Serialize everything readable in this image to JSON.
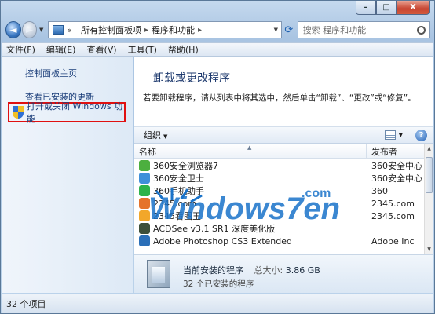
{
  "window": {
    "caption_min": "–",
    "caption_max": "□",
    "caption_close": "X"
  },
  "nav": {
    "back_glyph": "◄",
    "forward_glyph": "►",
    "address_prefix": "«",
    "address_crumbs": [
      "所有控制面板项",
      "程序和功能"
    ],
    "search_placeholder": "搜索 程序和功能"
  },
  "menu": [
    "文件(F)",
    "编辑(E)",
    "查看(V)",
    "工具(T)",
    "帮助(H)"
  ],
  "left_pane": {
    "links": [
      "控制面板主页",
      "查看已安装的更新"
    ],
    "feature_link": "打开或关闭 Windows 功能"
  },
  "main": {
    "title": "卸载或更改程序",
    "description": "若要卸载程序，请从列表中将其选中，然后单击“卸载”、“更改”或“修复”。",
    "organize_label": "组织",
    "columns": [
      "名称",
      "发布者"
    ],
    "programs": [
      {
        "name": "360安全浏览器7",
        "publisher": "360安全中心",
        "color": "#4caf3f"
      },
      {
        "name": "360安全卫士",
        "publisher": "360安全中心",
        "color": "#3f8fd9"
      },
      {
        "name": "360手机助手",
        "publisher": "360",
        "color": "#2db34a"
      },
      {
        "name": "2345.com",
        "publisher": "2345.com",
        "color": "#e5732b"
      },
      {
        "name": "2345看图王",
        "publisher": "2345.com",
        "color": "#f2a72a"
      },
      {
        "name": "ACDSee v3.1 SR1 深度美化版",
        "publisher": "",
        "color": "#3d4f3a"
      },
      {
        "name": "Adobe Photoshop CS3 Extended",
        "publisher": "Adobe Inc",
        "color": "#2b6fb8"
      }
    ],
    "details": {
      "current_label": "当前安装的程序",
      "size_label": "总大小:",
      "size_value": "3.86 GB",
      "count_text": "32 个已安装的程序"
    }
  },
  "status": {
    "items_text": "32 个项目"
  },
  "watermark": {
    "text": "Windows7en",
    "domain": ".com",
    "color": "#1a73c9"
  },
  "colors": {
    "highlight_border": "#e01010",
    "link": "#1b3e7a"
  }
}
